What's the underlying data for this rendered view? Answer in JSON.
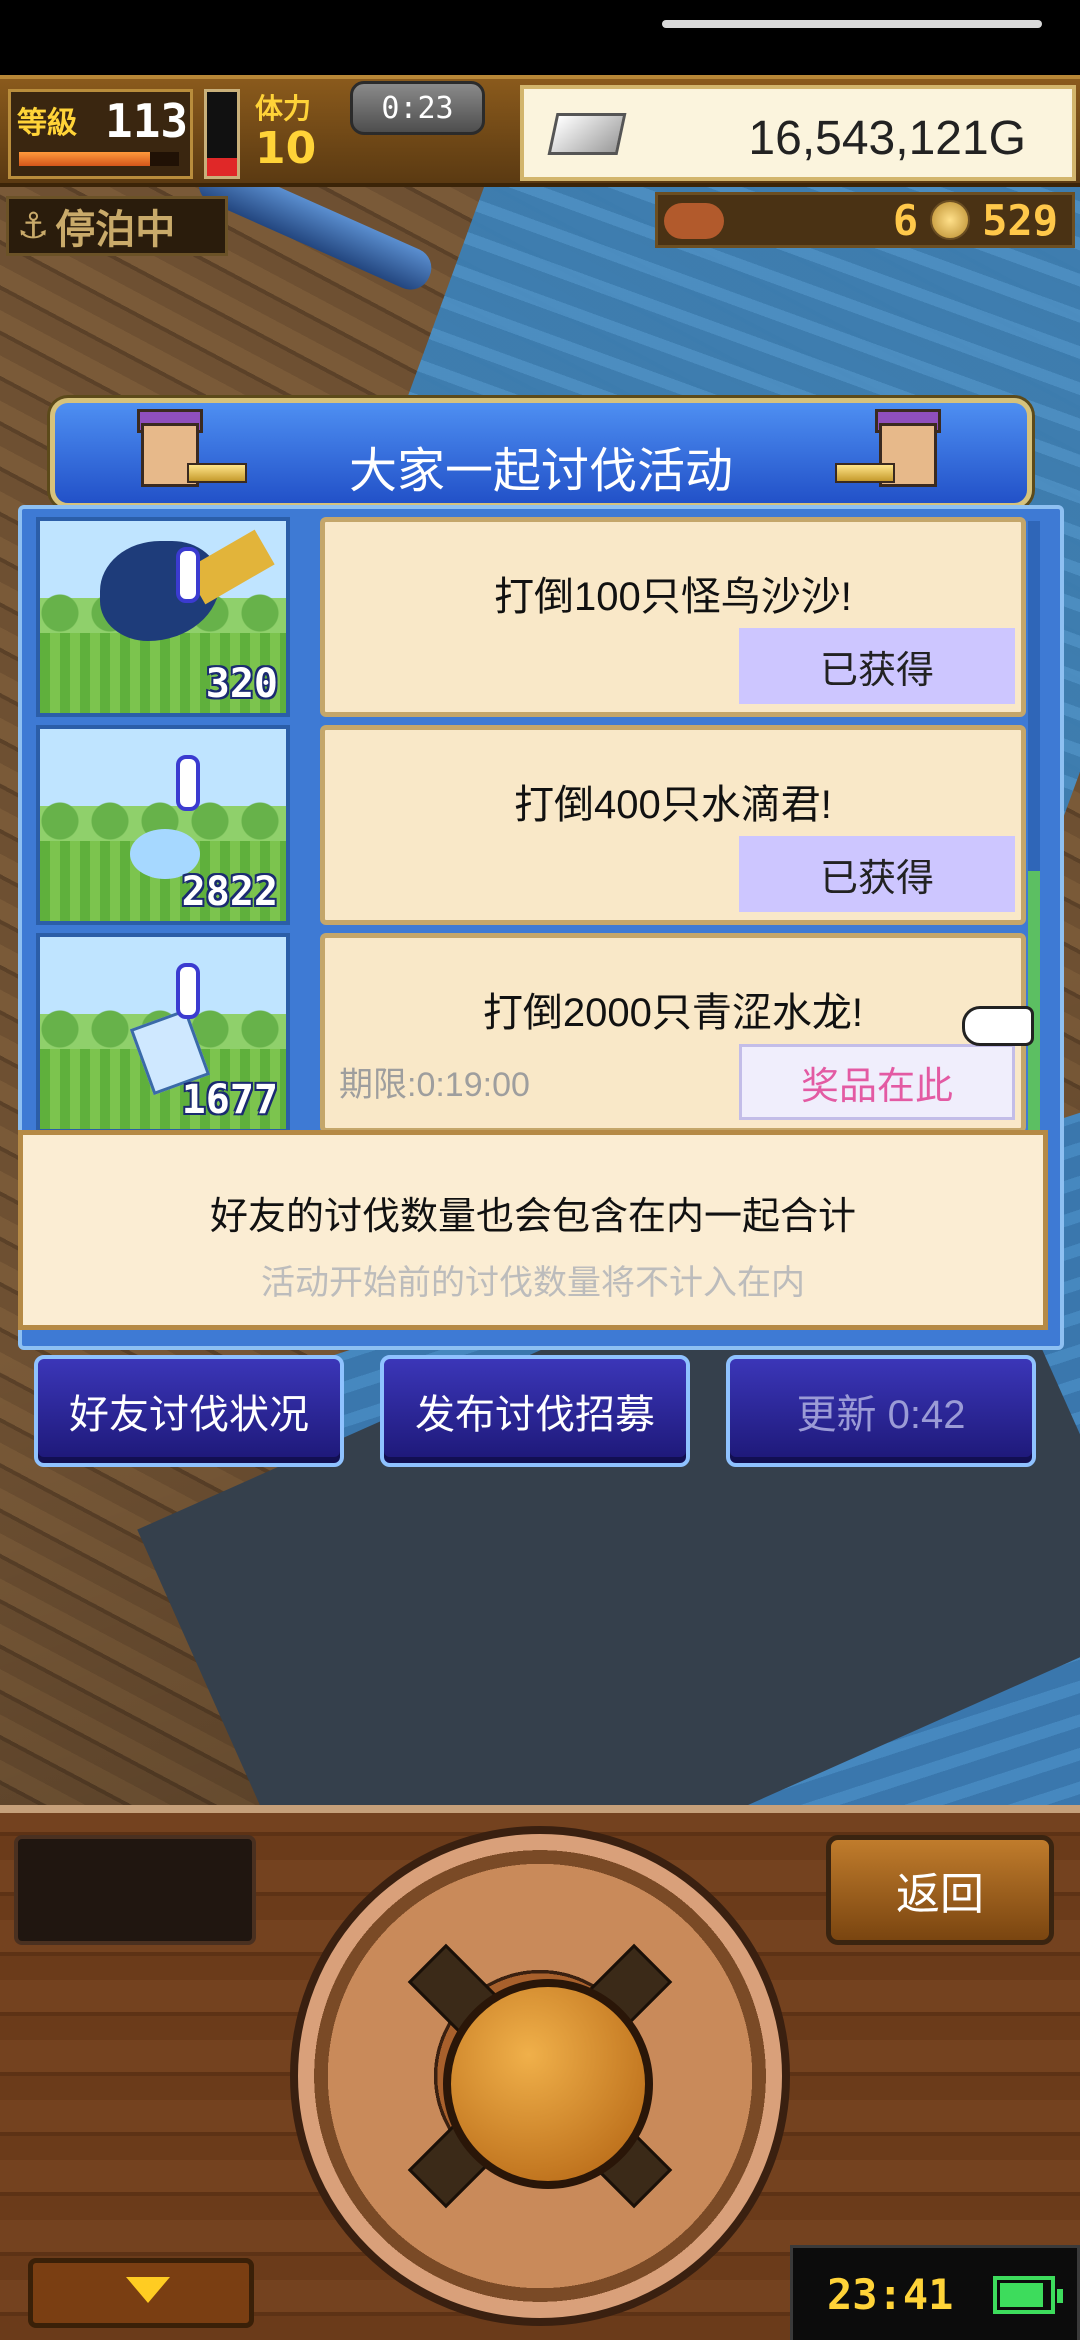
{
  "hud": {
    "level_label": "等級",
    "level": "113",
    "exp_fraction": 0.82,
    "hp_fraction": 0.22,
    "stamina_label": "体力",
    "stamina": "10",
    "timer": "0:23",
    "gold": "16,543,121G",
    "status": "停泊中",
    "resource_a": "6",
    "resource_b": "529"
  },
  "event": {
    "title": "大家一起讨伐活动",
    "rows": [
      {
        "count": "320",
        "goal": "打倒100只怪鸟沙沙!",
        "status": "已获得",
        "deadline": ""
      },
      {
        "count": "2822",
        "goal": "打倒400只水滴君!",
        "status": "已获得",
        "deadline": ""
      },
      {
        "count": "1677",
        "goal": "打倒2000只青涩水龙!",
        "status": "奖品在此",
        "deadline": "期限:0:19:00"
      }
    ],
    "info_main": "好友的讨伐数量也会包含在内一起合计",
    "info_sub": "活动开始前的讨伐数量将不计入在内"
  },
  "actions": {
    "friends_status": "好友讨伐状况",
    "post_recruit": "发布讨伐招募",
    "refresh": "更新 0:42"
  },
  "controls": {
    "back": "返回",
    "clock": "23:41",
    "battery_fraction": 0.85
  },
  "colors": {
    "panel_blue": "#3e7ad4",
    "card_bg": "#f9e8c8",
    "obtained_bg": "#cdc6ff",
    "prize_text": "#e35aa3"
  }
}
